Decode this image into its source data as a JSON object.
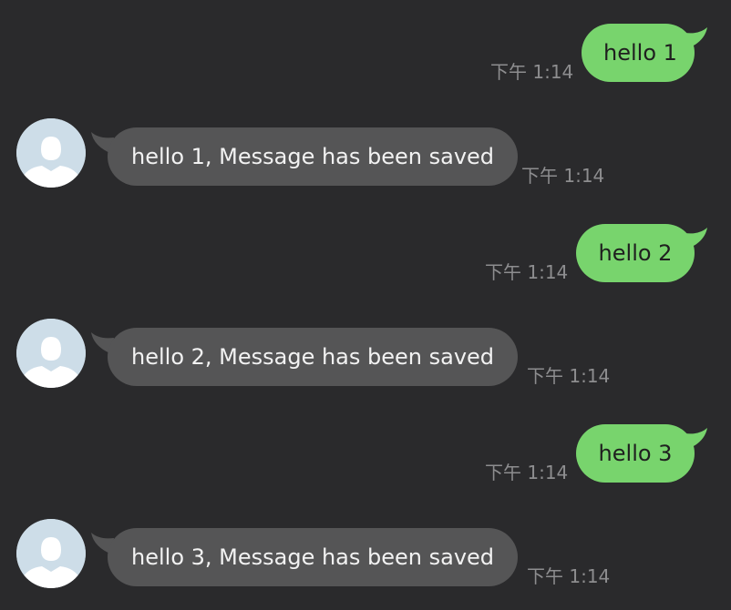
{
  "colors": {
    "background": "#2a2a2c",
    "outgoing_bubble": "#78d46d",
    "incoming_bubble": "#555556",
    "timestamp": "#8d8d8f",
    "avatar_bg": "#cddde8"
  },
  "messages": [
    {
      "direction": "outgoing",
      "text": "hello 1",
      "time": "下午 1:14"
    },
    {
      "direction": "incoming",
      "text": "hello 1, Message has been saved",
      "time": "下午 1:14",
      "avatar": "default-user-avatar"
    },
    {
      "direction": "outgoing",
      "text": "hello 2",
      "time": "下午 1:14"
    },
    {
      "direction": "incoming",
      "text": "hello 2, Message has been saved",
      "time": "下午 1:14",
      "avatar": "default-user-avatar"
    },
    {
      "direction": "outgoing",
      "text": "hello 3",
      "time": "下午 1:14"
    },
    {
      "direction": "incoming",
      "text": "hello 3, Message has been saved",
      "time": "下午 1:14",
      "avatar": "default-user-avatar"
    }
  ]
}
